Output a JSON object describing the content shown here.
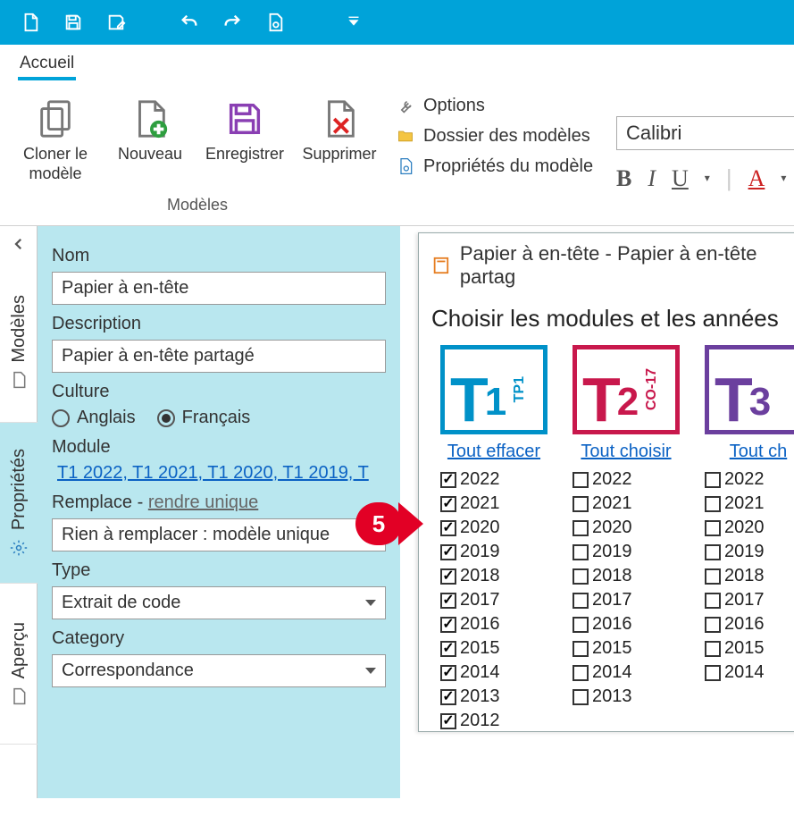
{
  "topbar_icons": [
    "new-doc-icon",
    "save-icon",
    "save-edit-icon",
    "undo-icon",
    "redo-icon",
    "settings-doc-icon",
    "dropdown-icon"
  ],
  "ribbon": {
    "tab": "Accueil",
    "group_label": "Modèles",
    "buttons": {
      "clone": "Cloner le modèle",
      "new": "Nouveau",
      "save": "Enregistrer",
      "delete": "Supprimer"
    },
    "links": {
      "options": "Options",
      "folder": "Dossier des modèles",
      "props": "Propriétés du modèle"
    },
    "font_name": "Calibri"
  },
  "side_tabs": {
    "models": "Modèles",
    "properties": "Propriétés",
    "preview": "Aperçu"
  },
  "form": {
    "name_label": "Nom",
    "name_value": "Papier à en-tête",
    "description_label": "Description",
    "description_value": "Papier à en-tête partagé",
    "culture_label": "Culture",
    "culture_en": "Anglais",
    "culture_fr": "Français",
    "module_label": "Module",
    "module_value": "T1 2022, T1 2021, T1 2020, T1 2019, T",
    "replace_label": "Remplace",
    "replace_sublink": "rendre unique",
    "replace_value": "Rien à remplacer : modèle unique",
    "type_label": "Type",
    "type_value": "Extrait de code",
    "category_label": "Category",
    "category_value": "Correspondance"
  },
  "marker_num": "5",
  "dialog": {
    "title": "Papier à en-tête - Papier à en-tête partag",
    "heading": "Choisir les modules et les années",
    "modules": [
      {
        "key": "t1",
        "big": "T",
        "num": "1",
        "side": "TP1",
        "link": "Tout effacer",
        "years": [
          {
            "y": "2022",
            "c": true
          },
          {
            "y": "2021",
            "c": true
          },
          {
            "y": "2020",
            "c": true
          },
          {
            "y": "2019",
            "c": true
          },
          {
            "y": "2018",
            "c": true
          },
          {
            "y": "2017",
            "c": true
          },
          {
            "y": "2016",
            "c": true
          },
          {
            "y": "2015",
            "c": true
          },
          {
            "y": "2014",
            "c": true
          },
          {
            "y": "2013",
            "c": true
          },
          {
            "y": "2012",
            "c": true
          }
        ]
      },
      {
        "key": "t2",
        "big": "T",
        "num": "2",
        "side": "CO-17",
        "link": "Tout choisir",
        "years": [
          {
            "y": "2022",
            "c": false
          },
          {
            "y": "2021",
            "c": false
          },
          {
            "y": "2020",
            "c": false
          },
          {
            "y": "2019",
            "c": false
          },
          {
            "y": "2018",
            "c": false
          },
          {
            "y": "2017",
            "c": false
          },
          {
            "y": "2016",
            "c": false
          },
          {
            "y": "2015",
            "c": false
          },
          {
            "y": "2014",
            "c": false
          },
          {
            "y": "2013",
            "c": false
          }
        ]
      },
      {
        "key": "t3",
        "big": "T",
        "num": "3",
        "side": "",
        "link": "Tout ch",
        "years": [
          {
            "y": "2022",
            "c": false
          },
          {
            "y": "2021",
            "c": false
          },
          {
            "y": "2020",
            "c": false
          },
          {
            "y": "2019",
            "c": false
          },
          {
            "y": "2018",
            "c": false
          },
          {
            "y": "2017",
            "c": false
          },
          {
            "y": "2016",
            "c": false
          },
          {
            "y": "2015",
            "c": false
          },
          {
            "y": "2014",
            "c": false
          }
        ]
      }
    ]
  }
}
